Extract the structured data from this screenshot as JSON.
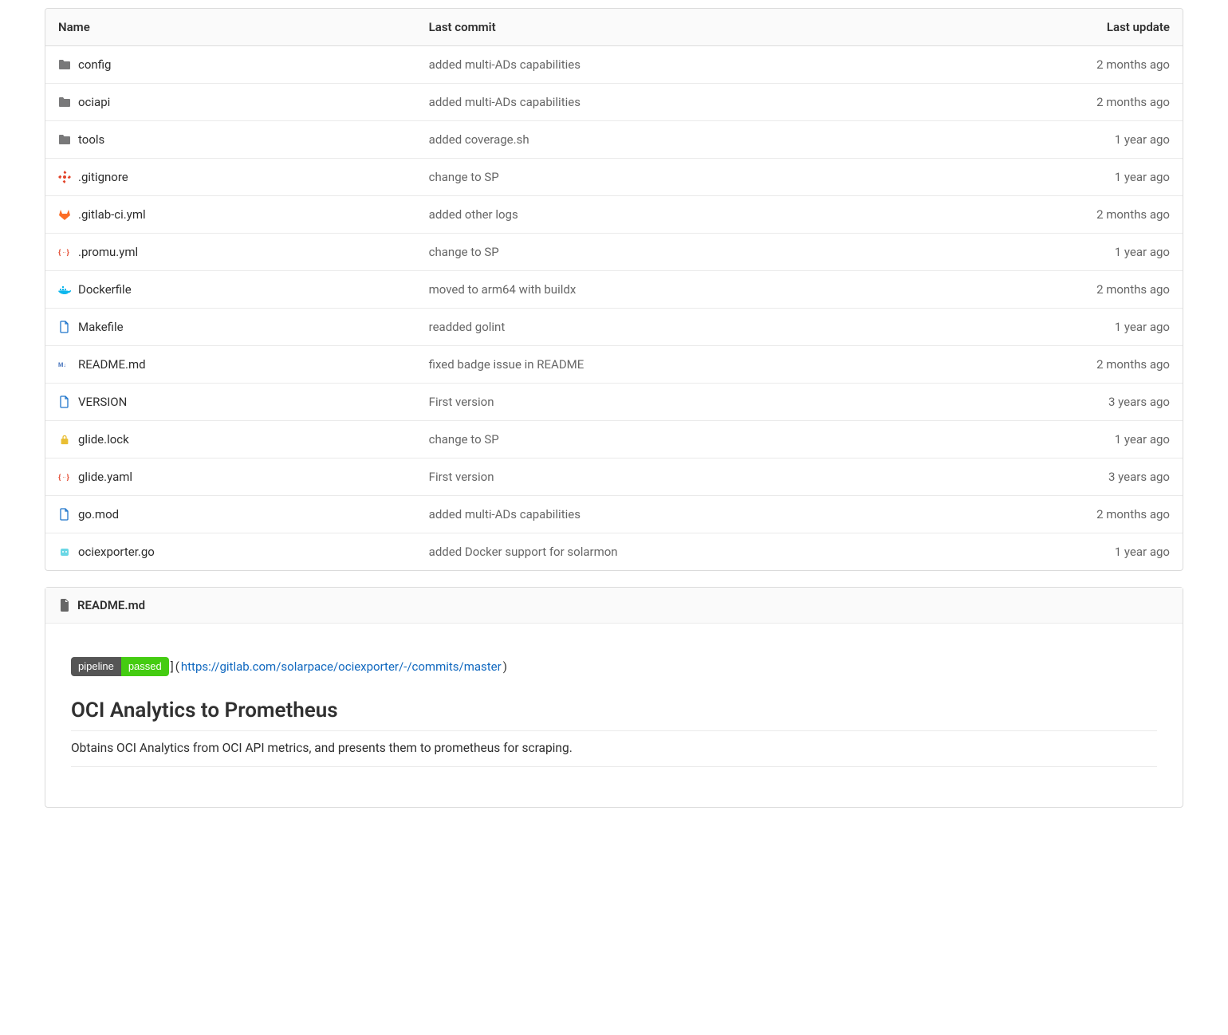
{
  "table": {
    "headers": {
      "name": "Name",
      "commit": "Last commit",
      "update": "Last update"
    },
    "rows": [
      {
        "icon": "folder",
        "name": "config",
        "commit": "added multi-ADs capabilities",
        "update": "2 months ago"
      },
      {
        "icon": "folder",
        "name": "ociapi",
        "commit": "added multi-ADs capabilities",
        "update": "2 months ago"
      },
      {
        "icon": "folder",
        "name": "tools",
        "commit": "added coverage.sh",
        "update": "1 year ago"
      },
      {
        "icon": "gitignore",
        "name": ".gitignore",
        "commit": "change to SP",
        "update": "1 year ago"
      },
      {
        "icon": "gitlab",
        "name": ".gitlab-ci.yml",
        "commit": "added other logs",
        "update": "2 months ago"
      },
      {
        "icon": "yaml",
        "name": ".promu.yml",
        "commit": "change to SP",
        "update": "1 year ago"
      },
      {
        "icon": "docker",
        "name": "Dockerfile",
        "commit": "moved to arm64 with buildx",
        "update": "2 months ago"
      },
      {
        "icon": "file",
        "name": "Makefile",
        "commit": "readded golint",
        "update": "1 year ago"
      },
      {
        "icon": "markdown",
        "name": "README.md",
        "commit": "fixed badge issue in README",
        "update": "2 months ago"
      },
      {
        "icon": "file",
        "name": "VERSION",
        "commit": "First version",
        "update": "3 years ago"
      },
      {
        "icon": "lock",
        "name": "glide.lock",
        "commit": "change to SP",
        "update": "1 year ago"
      },
      {
        "icon": "yaml",
        "name": "glide.yaml",
        "commit": "First version",
        "update": "3 years ago"
      },
      {
        "icon": "file",
        "name": "go.mod",
        "commit": "added multi-ADs capabilities",
        "update": "2 months ago"
      },
      {
        "icon": "go",
        "name": "ociexporter.go",
        "commit": "added Docker support for solarmon",
        "update": "1 year ago"
      }
    ]
  },
  "readme": {
    "filename": "README.md",
    "badge": {
      "left": "pipeline",
      "right": "passed"
    },
    "badge_bracket_left": "]",
    "badge_paren_left": "(",
    "badge_link": "https://gitlab.com/solarpace/ociexporter/-/commits/master",
    "badge_paren_right": ")",
    "heading": "OCI Analytics to Prometheus",
    "description": "Obtains OCI Analytics from OCI API metrics, and presents them to prometheus for scraping."
  }
}
